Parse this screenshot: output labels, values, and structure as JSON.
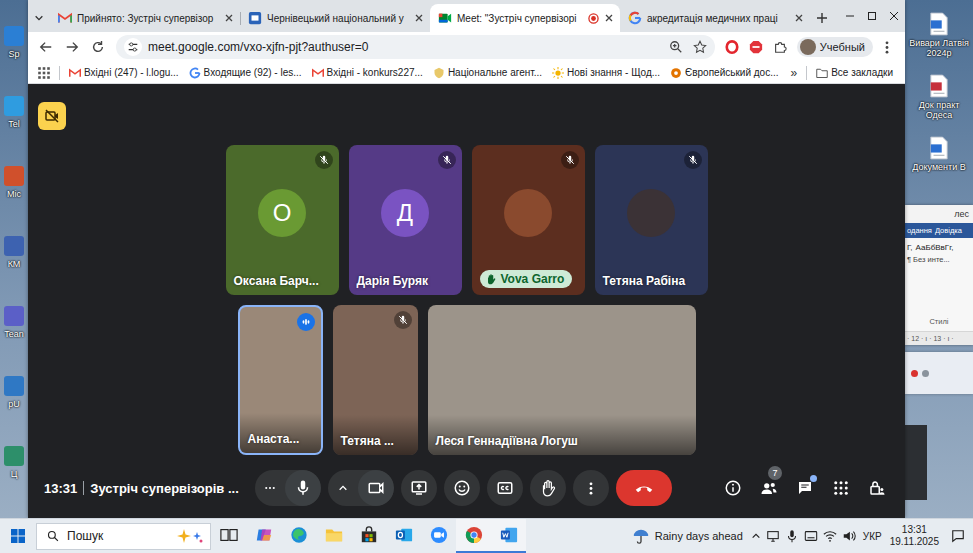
{
  "desktop": {
    "left_icons": [
      {
        "label": "Sp",
        "color": "#2b7fd4"
      },
      {
        "label": "Tel",
        "color": "#2f9ce0"
      },
      {
        "label": "Mic",
        "color": "#d0502c"
      },
      {
        "label": "КМ",
        "color": "#3d62b0"
      },
      {
        "label": "Tean",
        "color": "#5b5fc7"
      },
      {
        "label": "pU",
        "color": "#2f78c4"
      },
      {
        "label": "Ц",
        "color": "#2d8f6a"
      }
    ],
    "right_icons": [
      {
        "label": "Вивари Латвія 2024р",
        "color": "#2b6fd1"
      },
      {
        "label": "Док практ Одеса",
        "color": "#c6303c"
      },
      {
        "label": "Документи В",
        "color": "#2b6fd1"
      }
    ]
  },
  "word_window": {
    "title": "лес",
    "ribbon_tabs": [
      "одання",
      "Довідка"
    ],
    "styles_preview": [
      "Г,",
      "АаБбВвГг,"
    ],
    "style_name": "¶ Без инте...",
    "group_label": "Стилі",
    "ruler": "· 12 · ı · 13 · ı ·"
  },
  "browser": {
    "tabs": [
      {
        "label": "Прийнято: Зустріч супервізор",
        "icon": "gmail",
        "selected": false,
        "recording": false
      },
      {
        "label": "Чернівецький національний у",
        "icon": "site",
        "selected": false,
        "recording": false
      },
      {
        "label": "Meet: \"Зустріч супервізорі",
        "icon": "meet",
        "selected": true,
        "recording": true
      },
      {
        "label": "акредитація медичних праці",
        "icon": "google",
        "selected": false,
        "recording": false
      }
    ],
    "address": "meet.google.com/vxo-xjfn-pjt?authuser=0",
    "bookmarked": false,
    "profile": "Учебный",
    "bookmarks": [
      {
        "label": "Вхідні (247) - l.logu...",
        "icon": "gmail"
      },
      {
        "label": "Входящие (92) - les...",
        "icon": "google"
      },
      {
        "label": "Вхідні - konkurs227...",
        "icon": "gmail"
      },
      {
        "label": "Національне агент...",
        "icon": "agency"
      },
      {
        "label": "Нові знання - Щод...",
        "icon": "sun"
      },
      {
        "label": "Європейський дос...",
        "icon": "orange"
      }
    ],
    "bookmarks_more": "»",
    "all_bookmarks": "Все закладки"
  },
  "meet": {
    "time": "13:31",
    "title": "Зустріч супервізорів ...",
    "mic_on": true,
    "camera_on": true,
    "people_count": "7",
    "chat_unread": true,
    "rows": [
      {
        "tiles": [
          {
            "name": "Оксана Барч...",
            "kind": "avatar-letter",
            "initial": "О",
            "color": "#4b6a2b",
            "avatar_color": "#6a9a33",
            "muted": true,
            "speaking": false,
            "hand_raised": false
          },
          {
            "name": "Дарія Буряк",
            "kind": "avatar-letter",
            "initial": "Д",
            "color": "#553a86",
            "avatar_color": "#7a53c2",
            "muted": true,
            "speaking": false,
            "hand_raised": false
          },
          {
            "name": "Vova Garro",
            "kind": "avatar-photo",
            "initial": "",
            "color": "#5c2e1f",
            "avatar_color": "#8a4a2e",
            "muted": true,
            "speaking": false,
            "hand_raised": true
          },
          {
            "name": "Тетяна Рабіна",
            "kind": "avatar-photo",
            "initial": "",
            "color": "#2c3556",
            "avatar_color": "#3b3236",
            "muted": true,
            "speaking": false,
            "hand_raised": false
          }
        ]
      },
      {
        "tiles": [
          {
            "name": "Анаста...",
            "kind": "video-portrait",
            "initial": "",
            "color": "#9a8878",
            "avatar_color": "#9a8878",
            "muted": false,
            "speaking": true,
            "hand_raised": false
          },
          {
            "name": "Тетяна ...",
            "kind": "video-portrait",
            "initial": "",
            "color": "#7d6456",
            "avatar_color": "#7d6456",
            "muted": true,
            "speaking": false,
            "hand_raised": false
          },
          {
            "name": "Леся Геннадіївна Логуш",
            "kind": "video-landscape",
            "initial": "",
            "color": "#9c948a",
            "avatar_color": "#9c948a",
            "muted": false,
            "speaking": false,
            "hand_raised": false
          }
        ]
      }
    ]
  },
  "taskbar": {
    "search": "Пошук",
    "weather": "Rainy days ahead",
    "language": "УКР",
    "time": "13:31",
    "date": "19.11.2025",
    "apps": [
      {
        "kind": "task-view",
        "active": false
      },
      {
        "kind": "copilot",
        "active": false
      },
      {
        "kind": "edge",
        "active": false
      },
      {
        "kind": "explorer",
        "active": false
      },
      {
        "kind": "store",
        "active": false
      },
      {
        "kind": "outlook",
        "active": false
      },
      {
        "kind": "zoom",
        "active": false
      },
      {
        "kind": "chrome",
        "active": true
      },
      {
        "kind": "word",
        "active": true
      }
    ]
  }
}
